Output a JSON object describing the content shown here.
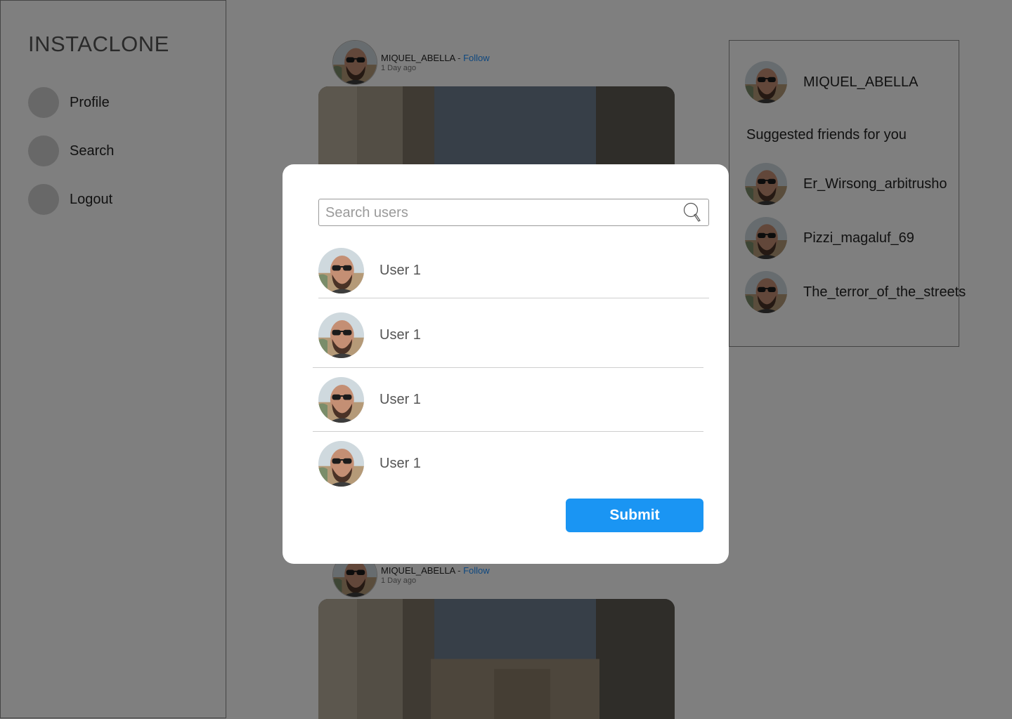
{
  "app": {
    "logo": "INSTACLONE"
  },
  "sidebar": {
    "items": [
      {
        "label": "Profile"
      },
      {
        "label": "Search"
      },
      {
        "label": "Logout"
      }
    ]
  },
  "feed": {
    "posts": [
      {
        "username": "MIQUEL_ABELLA",
        "separator": "-",
        "follow": "Follow",
        "time": "1 Day ago"
      },
      {
        "username": "MIQUEL_ABELLA",
        "separator": "-",
        "follow": "Follow",
        "time": "1 Day ago"
      }
    ]
  },
  "right_panel": {
    "current_user": "MIQUEL_ABELLA",
    "suggest_title": "Suggested friends for you",
    "suggestions": [
      {
        "name": "Er_Wirsong_arbitrusho"
      },
      {
        "name": "Pizzi_magaluf_69"
      },
      {
        "name": "The_terror_of_the_streets"
      }
    ]
  },
  "modal": {
    "search_placeholder": "Search users",
    "search_value": "",
    "results": [
      {
        "name": "User 1"
      },
      {
        "name": "User 1"
      },
      {
        "name": "User 1"
      },
      {
        "name": "User 1"
      }
    ],
    "submit_label": "Submit"
  },
  "colors": {
    "accent": "#1a95f3",
    "follow_link": "#1e90ff",
    "overlay": "rgba(0,0,0,0.5)"
  }
}
